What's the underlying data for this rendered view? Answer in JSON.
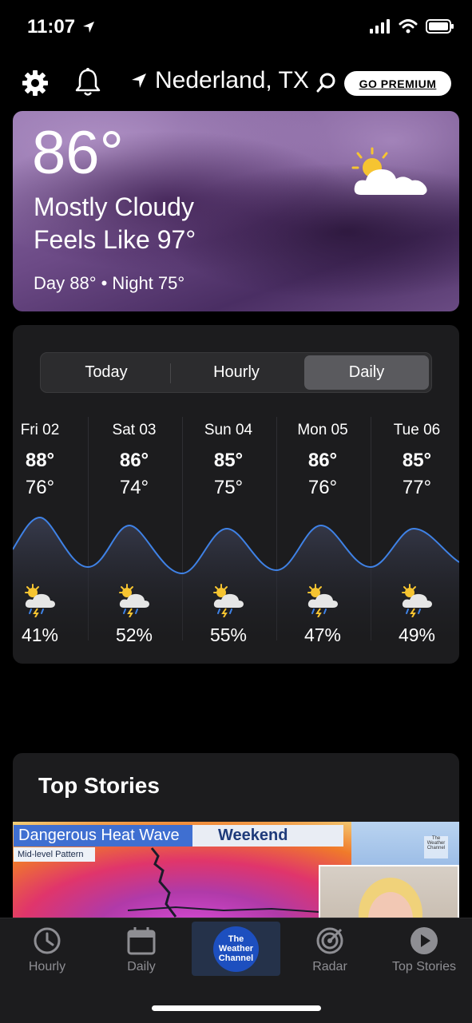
{
  "status_bar": {
    "time": "11:07"
  },
  "header": {
    "location": "Nederland, TX",
    "premium_label": "GO PREMIUM",
    "icons": [
      "gear-icon",
      "bell-icon",
      "location-arrow-icon",
      "search-icon"
    ]
  },
  "current": {
    "temp": "86°",
    "condition": "Mostly Cloudy",
    "feels_like": "Feels Like 97°",
    "day_night": "Day 88° • Night 75°",
    "icon": "partly-cloudy-icon"
  },
  "forecast": {
    "tabs": [
      "Today",
      "Hourly",
      "Daily"
    ],
    "active_tab": "Daily",
    "days": [
      {
        "day": "Fri 02",
        "hi": "88°",
        "lo": "76°",
        "precip": "41%",
        "icon": "thunderstorm-icon"
      },
      {
        "day": "Sat 03",
        "hi": "86°",
        "lo": "74°",
        "precip": "52%",
        "icon": "thunderstorm-icon"
      },
      {
        "day": "Sun 04",
        "hi": "85°",
        "lo": "75°",
        "precip": "55%",
        "icon": "thunderstorm-icon"
      },
      {
        "day": "Mon 05",
        "hi": "86°",
        "lo": "76°",
        "precip": "47%",
        "icon": "thunderstorm-icon"
      },
      {
        "day": "Tue 06",
        "hi": "85°",
        "lo": "77°",
        "precip": "49%",
        "icon": "thunderstorm-icon"
      }
    ]
  },
  "stories": {
    "title": "Top Stories",
    "banner_main": "Dangerous Heat Wave",
    "banner_right": "Weekend",
    "banner_sub": "Mid-level Pattern",
    "small_logo": "The Weather Channel"
  },
  "tabbar": {
    "items": [
      {
        "label": "Hourly",
        "icon": "clock-icon"
      },
      {
        "label": "Daily",
        "icon": "calendar-icon"
      },
      {
        "label": "",
        "icon": "weather-channel-logo"
      },
      {
        "label": "Radar",
        "icon": "radar-icon"
      },
      {
        "label": "Top Stories",
        "icon": "play-icon"
      }
    ],
    "logo_text": "The Weather Channel"
  },
  "colors": {
    "accent_curve": "#3f82e6",
    "premium_bg": "#ffffff",
    "card_bg": "#1c1c1e"
  }
}
